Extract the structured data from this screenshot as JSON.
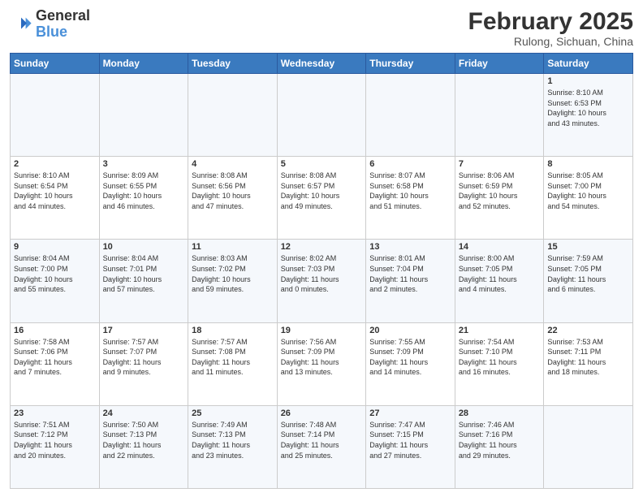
{
  "header": {
    "logo_general": "General",
    "logo_blue": "Blue",
    "month_title": "February 2025",
    "location": "Rulong, Sichuan, China"
  },
  "days_of_week": [
    "Sunday",
    "Monday",
    "Tuesday",
    "Wednesday",
    "Thursday",
    "Friday",
    "Saturday"
  ],
  "weeks": [
    [
      {
        "day": "",
        "info": ""
      },
      {
        "day": "",
        "info": ""
      },
      {
        "day": "",
        "info": ""
      },
      {
        "day": "",
        "info": ""
      },
      {
        "day": "",
        "info": ""
      },
      {
        "day": "",
        "info": ""
      },
      {
        "day": "1",
        "info": "Sunrise: 8:10 AM\nSunset: 6:53 PM\nDaylight: 10 hours\nand 43 minutes."
      }
    ],
    [
      {
        "day": "2",
        "info": "Sunrise: 8:10 AM\nSunset: 6:54 PM\nDaylight: 10 hours\nand 44 minutes."
      },
      {
        "day": "3",
        "info": "Sunrise: 8:09 AM\nSunset: 6:55 PM\nDaylight: 10 hours\nand 46 minutes."
      },
      {
        "day": "4",
        "info": "Sunrise: 8:08 AM\nSunset: 6:56 PM\nDaylight: 10 hours\nand 47 minutes."
      },
      {
        "day": "5",
        "info": "Sunrise: 8:08 AM\nSunset: 6:57 PM\nDaylight: 10 hours\nand 49 minutes."
      },
      {
        "day": "6",
        "info": "Sunrise: 8:07 AM\nSunset: 6:58 PM\nDaylight: 10 hours\nand 51 minutes."
      },
      {
        "day": "7",
        "info": "Sunrise: 8:06 AM\nSunset: 6:59 PM\nDaylight: 10 hours\nand 52 minutes."
      },
      {
        "day": "8",
        "info": "Sunrise: 8:05 AM\nSunset: 7:00 PM\nDaylight: 10 hours\nand 54 minutes."
      }
    ],
    [
      {
        "day": "9",
        "info": "Sunrise: 8:04 AM\nSunset: 7:00 PM\nDaylight: 10 hours\nand 55 minutes."
      },
      {
        "day": "10",
        "info": "Sunrise: 8:04 AM\nSunset: 7:01 PM\nDaylight: 10 hours\nand 57 minutes."
      },
      {
        "day": "11",
        "info": "Sunrise: 8:03 AM\nSunset: 7:02 PM\nDaylight: 10 hours\nand 59 minutes."
      },
      {
        "day": "12",
        "info": "Sunrise: 8:02 AM\nSunset: 7:03 PM\nDaylight: 11 hours\nand 0 minutes."
      },
      {
        "day": "13",
        "info": "Sunrise: 8:01 AM\nSunset: 7:04 PM\nDaylight: 11 hours\nand 2 minutes."
      },
      {
        "day": "14",
        "info": "Sunrise: 8:00 AM\nSunset: 7:05 PM\nDaylight: 11 hours\nand 4 minutes."
      },
      {
        "day": "15",
        "info": "Sunrise: 7:59 AM\nSunset: 7:05 PM\nDaylight: 11 hours\nand 6 minutes."
      }
    ],
    [
      {
        "day": "16",
        "info": "Sunrise: 7:58 AM\nSunset: 7:06 PM\nDaylight: 11 hours\nand 7 minutes."
      },
      {
        "day": "17",
        "info": "Sunrise: 7:57 AM\nSunset: 7:07 PM\nDaylight: 11 hours\nand 9 minutes."
      },
      {
        "day": "18",
        "info": "Sunrise: 7:57 AM\nSunset: 7:08 PM\nDaylight: 11 hours\nand 11 minutes."
      },
      {
        "day": "19",
        "info": "Sunrise: 7:56 AM\nSunset: 7:09 PM\nDaylight: 11 hours\nand 13 minutes."
      },
      {
        "day": "20",
        "info": "Sunrise: 7:55 AM\nSunset: 7:09 PM\nDaylight: 11 hours\nand 14 minutes."
      },
      {
        "day": "21",
        "info": "Sunrise: 7:54 AM\nSunset: 7:10 PM\nDaylight: 11 hours\nand 16 minutes."
      },
      {
        "day": "22",
        "info": "Sunrise: 7:53 AM\nSunset: 7:11 PM\nDaylight: 11 hours\nand 18 minutes."
      }
    ],
    [
      {
        "day": "23",
        "info": "Sunrise: 7:51 AM\nSunset: 7:12 PM\nDaylight: 11 hours\nand 20 minutes."
      },
      {
        "day": "24",
        "info": "Sunrise: 7:50 AM\nSunset: 7:13 PM\nDaylight: 11 hours\nand 22 minutes."
      },
      {
        "day": "25",
        "info": "Sunrise: 7:49 AM\nSunset: 7:13 PM\nDaylight: 11 hours\nand 23 minutes."
      },
      {
        "day": "26",
        "info": "Sunrise: 7:48 AM\nSunset: 7:14 PM\nDaylight: 11 hours\nand 25 minutes."
      },
      {
        "day": "27",
        "info": "Sunrise: 7:47 AM\nSunset: 7:15 PM\nDaylight: 11 hours\nand 27 minutes."
      },
      {
        "day": "28",
        "info": "Sunrise: 7:46 AM\nSunset: 7:16 PM\nDaylight: 11 hours\nand 29 minutes."
      },
      {
        "day": "",
        "info": ""
      }
    ]
  ]
}
